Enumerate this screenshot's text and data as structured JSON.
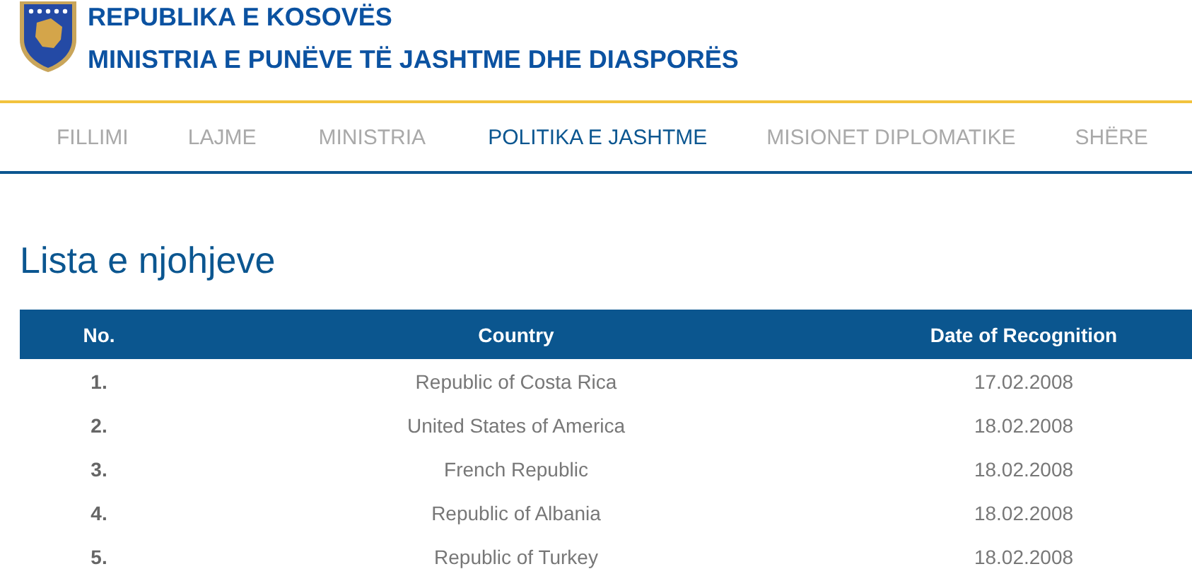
{
  "header": {
    "title": "REPUBLIKA E KOSOVËS",
    "subtitle": "MINISTRIA E PUNËVE TË JASHTME DHE DIASPORËS"
  },
  "nav": [
    {
      "label": "FILLIMI",
      "selected": false
    },
    {
      "label": "LAJME",
      "selected": false
    },
    {
      "label": "MINISTRIA",
      "selected": false
    },
    {
      "label": "POLITIKA E JASHTME",
      "selected": true
    },
    {
      "label": "MISIONET DIPLOMATIKE",
      "selected": false
    },
    {
      "label": "SHËRE",
      "selected": false
    }
  ],
  "page_title": "Lista e njohjeve",
  "table": {
    "columns": [
      "No.",
      "Country",
      "Date of Recognition"
    ],
    "rows": [
      [
        "1.",
        "Republic of Costa Rica",
        "17.02.2008"
      ],
      [
        "2.",
        "United States of America",
        "18.02.2008"
      ],
      [
        "3.",
        "French Republic",
        "18.02.2008"
      ],
      [
        "4.",
        "Republic of Albania",
        "18.02.2008"
      ],
      [
        "5.",
        "Republic of Turkey",
        "18.02.2008"
      ]
    ]
  }
}
